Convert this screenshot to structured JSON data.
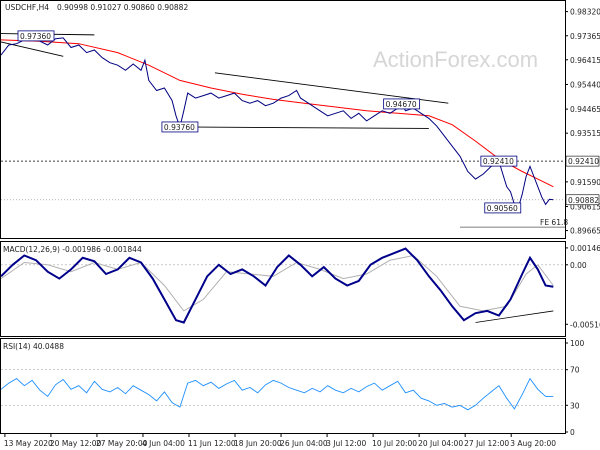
{
  "header": {
    "symbol": "USDCHF,H4",
    "ohlc": "0.90998 0.91027 0.90860 0.90882"
  },
  "watermark": "ActionForex.com",
  "colors": {
    "price": "#000080",
    "ma": "#ff0000",
    "macd": "#00008b",
    "macd_signal": "#b0b0b0",
    "rsi": "#1e90ff",
    "level": "#000000",
    "trend": "#000000"
  },
  "chart_data": [
    {
      "type": "line",
      "name": "price",
      "y_ticks": [
        "0.98320",
        "0.97365",
        "0.96415",
        "0.95440",
        "0.94465",
        "0.93515",
        "0.91590",
        "0.90615",
        "0.89665"
      ],
      "ylim": [
        0.8945,
        0.9862
      ],
      "level_price": 0.9241,
      "level_tag": "0.92410",
      "current_tag": "0.90882",
      "fe_label": "FE 61.8",
      "fe_price": 0.898,
      "labels": [
        {
          "text": "0.97360",
          "t": 9,
          "v": 0.9736
        },
        {
          "text": "0.93760",
          "t": 46,
          "v": 0.9376
        },
        {
          "text": "0.94670",
          "t": 103,
          "v": 0.9467
        },
        {
          "text": "0.92410",
          "t": 128,
          "v": 0.9241
        },
        {
          "text": "0.90560",
          "t": 129,
          "v": 0.9056
        }
      ],
      "close_points": [
        [
          0,
          0.966
        ],
        [
          2,
          0.97
        ],
        [
          4,
          0.9705
        ],
        [
          6,
          0.972
        ],
        [
          8,
          0.9736
        ],
        [
          10,
          0.9715
        ],
        [
          12,
          0.97
        ],
        [
          14,
          0.9725
        ],
        [
          16,
          0.9728
        ],
        [
          18,
          0.969
        ],
        [
          20,
          0.97
        ],
        [
          22,
          0.967
        ],
        [
          24,
          0.968
        ],
        [
          26,
          0.965
        ],
        [
          28,
          0.963
        ],
        [
          30,
          0.962
        ],
        [
          32,
          0.96
        ],
        [
          34,
          0.9625
        ],
        [
          36,
          0.96
        ],
        [
          37,
          0.964
        ],
        [
          38,
          0.956
        ],
        [
          40,
          0.952
        ],
        [
          42,
          0.953
        ],
        [
          44,
          0.948
        ],
        [
          45,
          0.942
        ],
        [
          46,
          0.9376
        ],
        [
          47,
          0.944
        ],
        [
          48,
          0.951
        ],
        [
          50,
          0.949
        ],
        [
          52,
          0.95
        ],
        [
          54,
          0.951
        ],
        [
          56,
          0.949
        ],
        [
          58,
          0.95
        ],
        [
          60,
          0.951
        ],
        [
          62,
          0.948
        ],
        [
          64,
          0.947
        ],
        [
          66,
          0.948
        ],
        [
          68,
          0.946
        ],
        [
          70,
          0.947
        ],
        [
          72,
          0.949
        ],
        [
          74,
          0.95
        ],
        [
          76,
          0.952
        ],
        [
          77,
          0.949
        ],
        [
          78,
          0.948
        ],
        [
          80,
          0.946
        ],
        [
          82,
          0.944
        ],
        [
          84,
          0.942
        ],
        [
          86,
          0.943
        ],
        [
          88,
          0.944
        ],
        [
          90,
          0.941
        ],
        [
          92,
          0.943
        ],
        [
          94,
          0.94
        ],
        [
          96,
          0.942
        ],
        [
          98,
          0.944
        ],
        [
          100,
          0.943
        ],
        [
          102,
          0.945
        ],
        [
          103,
          0.9467
        ],
        [
          104,
          0.944
        ],
        [
          106,
          0.945
        ],
        [
          108,
          0.943
        ],
        [
          110,
          0.941
        ],
        [
          112,
          0.938
        ],
        [
          114,
          0.934
        ],
        [
          116,
          0.93
        ],
        [
          118,
          0.926
        ],
        [
          120,
          0.92
        ],
        [
          122,
          0.917
        ],
        [
          124,
          0.919
        ],
        [
          126,
          0.922
        ],
        [
          128,
          0.9241
        ],
        [
          129,
          0.919
        ],
        [
          130,
          0.914
        ],
        [
          131,
          0.912
        ],
        [
          132,
          0.907
        ],
        [
          133,
          0.9056
        ],
        [
          134,
          0.911
        ],
        [
          135,
          0.918
        ],
        [
          136,
          0.922
        ],
        [
          137,
          0.918
        ],
        [
          138,
          0.914
        ],
        [
          139,
          0.91
        ],
        [
          140,
          0.907
        ],
        [
          141,
          0.909
        ],
        [
          142,
          0.9088
        ]
      ],
      "ma_points": [
        [
          0,
          0.972
        ],
        [
          10,
          0.9715
        ],
        [
          20,
          0.9705
        ],
        [
          30,
          0.967
        ],
        [
          38,
          0.962
        ],
        [
          46,
          0.956
        ],
        [
          54,
          0.953
        ],
        [
          62,
          0.9505
        ],
        [
          70,
          0.9485
        ],
        [
          78,
          0.947
        ],
        [
          86,
          0.9455
        ],
        [
          94,
          0.944
        ],
        [
          102,
          0.943
        ],
        [
          110,
          0.942
        ],
        [
          116,
          0.9385
        ],
        [
          122,
          0.932
        ],
        [
          128,
          0.925
        ],
        [
          134,
          0.92
        ],
        [
          138,
          0.917
        ],
        [
          142,
          0.914
        ]
      ],
      "trendlines": [
        {
          "from": [
            0,
            0.9712
          ],
          "to": [
            16,
            0.9655
          ]
        },
        {
          "from": [
            0,
            0.9745
          ],
          "to": [
            24,
            0.974
          ]
        },
        {
          "from": [
            55,
            0.959
          ],
          "to": [
            115,
            0.947
          ]
        },
        {
          "from": [
            46,
            0.9376
          ],
          "to": [
            110,
            0.937
          ]
        }
      ]
    },
    {
      "type": "line",
      "name": "macd",
      "label": "MACD(12,26,9) -0.001986 -0.001844",
      "y_ticks": [
        "0.001461",
        "0.00",
        "-0.00516"
      ],
      "ylim": [
        -0.006,
        0.0018
      ],
      "macd_points": [
        [
          0,
          -0.001
        ],
        [
          3,
          0.0
        ],
        [
          6,
          0.0008
        ],
        [
          9,
          0.0004
        ],
        [
          12,
          -0.0006
        ],
        [
          15,
          -0.0012
        ],
        [
          18,
          -0.0004
        ],
        [
          21,
          0.0006
        ],
        [
          24,
          0.0003
        ],
        [
          27,
          -0.0008
        ],
        [
          30,
          -0.0004
        ],
        [
          33,
          0.0006
        ],
        [
          36,
          0.0002
        ],
        [
          39,
          -0.0012
        ],
        [
          42,
          -0.003
        ],
        [
          45,
          -0.0048
        ],
        [
          47,
          -0.005
        ],
        [
          50,
          -0.003
        ],
        [
          53,
          -0.001
        ],
        [
          56,
          0.0
        ],
        [
          59,
          -0.0008
        ],
        [
          62,
          -0.0004
        ],
        [
          65,
          -0.001
        ],
        [
          68,
          -0.0018
        ],
        [
          71,
          -0.0002
        ],
        [
          74,
          0.0008
        ],
        [
          77,
          0.0
        ],
        [
          80,
          -0.001
        ],
        [
          83,
          -0.0002
        ],
        [
          86,
          -0.0012
        ],
        [
          89,
          -0.0018
        ],
        [
          92,
          -0.0014
        ],
        [
          95,
          0.0
        ],
        [
          98,
          0.0006
        ],
        [
          101,
          0.001
        ],
        [
          104,
          0.0014
        ],
        [
          107,
          0.0004
        ],
        [
          110,
          -0.001
        ],
        [
          113,
          -0.0022
        ],
        [
          116,
          -0.0036
        ],
        [
          119,
          -0.0048
        ],
        [
          122,
          -0.0042
        ],
        [
          125,
          -0.004
        ],
        [
          128,
          -0.0044
        ],
        [
          131,
          -0.003
        ],
        [
          134,
          -0.0008
        ],
        [
          136,
          0.0006
        ],
        [
          138,
          -0.0004
        ],
        [
          140,
          -0.0018
        ],
        [
          142,
          -0.0019
        ]
      ],
      "signal_points": [
        [
          0,
          -0.0012
        ],
        [
          6,
          0.0002
        ],
        [
          12,
          0.0
        ],
        [
          18,
          -0.0006
        ],
        [
          24,
          0.0002
        ],
        [
          30,
          -0.0004
        ],
        [
          36,
          0.0002
        ],
        [
          42,
          -0.0018
        ],
        [
          47,
          -0.004
        ],
        [
          52,
          -0.003
        ],
        [
          58,
          -0.0006
        ],
        [
          64,
          -0.0008
        ],
        [
          70,
          -0.001
        ],
        [
          76,
          0.0002
        ],
        [
          82,
          -0.0004
        ],
        [
          88,
          -0.0012
        ],
        [
          94,
          -0.0008
        ],
        [
          100,
          0.0004
        ],
        [
          106,
          0.0008
        ],
        [
          112,
          -0.001
        ],
        [
          118,
          -0.0036
        ],
        [
          124,
          -0.004
        ],
        [
          130,
          -0.0036
        ],
        [
          135,
          -0.0008
        ],
        [
          138,
          0.0
        ],
        [
          142,
          -0.0018
        ]
      ],
      "trendlines": [
        {
          "from": [
            122,
            -0.005
          ],
          "to": [
            142,
            -0.004
          ]
        }
      ]
    },
    {
      "type": "line",
      "name": "rsi",
      "label": "RSI(14) 40.0488",
      "y_ticks": [
        "100",
        "70",
        "30",
        "0"
      ],
      "ylim": [
        0,
        100
      ],
      "rsi_points": [
        [
          0,
          48
        ],
        [
          2,
          55
        ],
        [
          4,
          60
        ],
        [
          6,
          52
        ],
        [
          8,
          58
        ],
        [
          10,
          47
        ],
        [
          12,
          40
        ],
        [
          14,
          53
        ],
        [
          16,
          59
        ],
        [
          18,
          48
        ],
        [
          20,
          52
        ],
        [
          22,
          44
        ],
        [
          24,
          57
        ],
        [
          26,
          48
        ],
        [
          28,
          45
        ],
        [
          30,
          50
        ],
        [
          32,
          43
        ],
        [
          34,
          52
        ],
        [
          36,
          47
        ],
        [
          38,
          42
        ],
        [
          40,
          35
        ],
        [
          42,
          45
        ],
        [
          44,
          33
        ],
        [
          46,
          28
        ],
        [
          48,
          55
        ],
        [
          50,
          58
        ],
        [
          52,
          52
        ],
        [
          54,
          56
        ],
        [
          56,
          49
        ],
        [
          58,
          54
        ],
        [
          60,
          58
        ],
        [
          62,
          47
        ],
        [
          64,
          50
        ],
        [
          66,
          44
        ],
        [
          68,
          53
        ],
        [
          70,
          58
        ],
        [
          72,
          55
        ],
        [
          74,
          50
        ],
        [
          76,
          47
        ],
        [
          78,
          44
        ],
        [
          80,
          49
        ],
        [
          82,
          45
        ],
        [
          84,
          52
        ],
        [
          86,
          47
        ],
        [
          88,
          44
        ],
        [
          90,
          49
        ],
        [
          92,
          45
        ],
        [
          94,
          51
        ],
        [
          96,
          55
        ],
        [
          98,
          47
        ],
        [
          100,
          52
        ],
        [
          102,
          57
        ],
        [
          104,
          44
        ],
        [
          106,
          47
        ],
        [
          108,
          38
        ],
        [
          110,
          35
        ],
        [
          112,
          30
        ],
        [
          114,
          32
        ],
        [
          116,
          28
        ],
        [
          118,
          30
        ],
        [
          120,
          25
        ],
        [
          122,
          30
        ],
        [
          124,
          38
        ],
        [
          126,
          45
        ],
        [
          128,
          52
        ],
        [
          130,
          38
        ],
        [
          132,
          26
        ],
        [
          134,
          42
        ],
        [
          136,
          60
        ],
        [
          138,
          48
        ],
        [
          140,
          40
        ],
        [
          142,
          40
        ]
      ]
    }
  ],
  "x_axis": {
    "labels": [
      "13 May 2020",
      "20 May 12:00",
      "27 May 20:00",
      "4 Jun 04:00",
      "11 Jun 12:00",
      "18 Jun 20:00",
      "26 Jun 04:00",
      "3 Jul 12:00",
      "10 Jul 20:00",
      "20 Jul 04:00",
      "27 Jul 12:00",
      "3 Aug 20:00"
    ],
    "xlim": [
      0,
      145
    ]
  }
}
